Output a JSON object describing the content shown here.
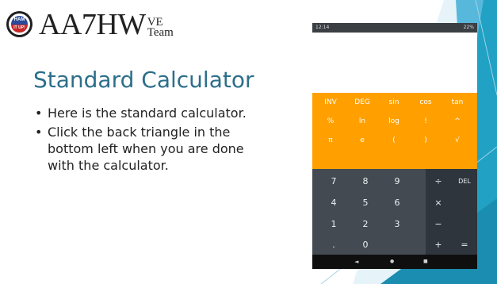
{
  "logo": {
    "callsign": "AA7HW",
    "sub_top": "VE",
    "sub_bottom": "Team",
    "badge_top": "HAM",
    "badge_bottom": "IT UP!"
  },
  "slide": {
    "title": "Standard Calculator",
    "bullets": [
      "Here is the standard calculator.",
      "Click the back triangle in the bottom left when you are done with the calculator."
    ]
  },
  "phone": {
    "status_time": "12:14",
    "status_right": "22%",
    "sci_rows": [
      [
        "INV",
        "DEG",
        "sin",
        "cos",
        "tan"
      ],
      [
        "%",
        "ln",
        "log",
        "!",
        "^"
      ],
      [
        "π",
        "e",
        "(",
        ")",
        "√"
      ]
    ],
    "num_rows": [
      [
        "7",
        "8",
        "9"
      ],
      [
        "4",
        "5",
        "6"
      ],
      [
        "1",
        "2",
        "3"
      ],
      [
        ".",
        "0",
        ""
      ]
    ],
    "op_rows": [
      [
        "÷",
        "DEL"
      ],
      [
        "×",
        ""
      ],
      [
        "−",
        ""
      ],
      [
        "+",
        "="
      ]
    ],
    "nav": {
      "back": "◄",
      "home": "●",
      "recents": "■"
    }
  },
  "colors": {
    "accent": "#2c6f8a",
    "calc_orange": "#ffa000",
    "calc_dark": "#434a52",
    "calc_ops": "#2e353c",
    "slide_teal": "#21a1c4"
  }
}
